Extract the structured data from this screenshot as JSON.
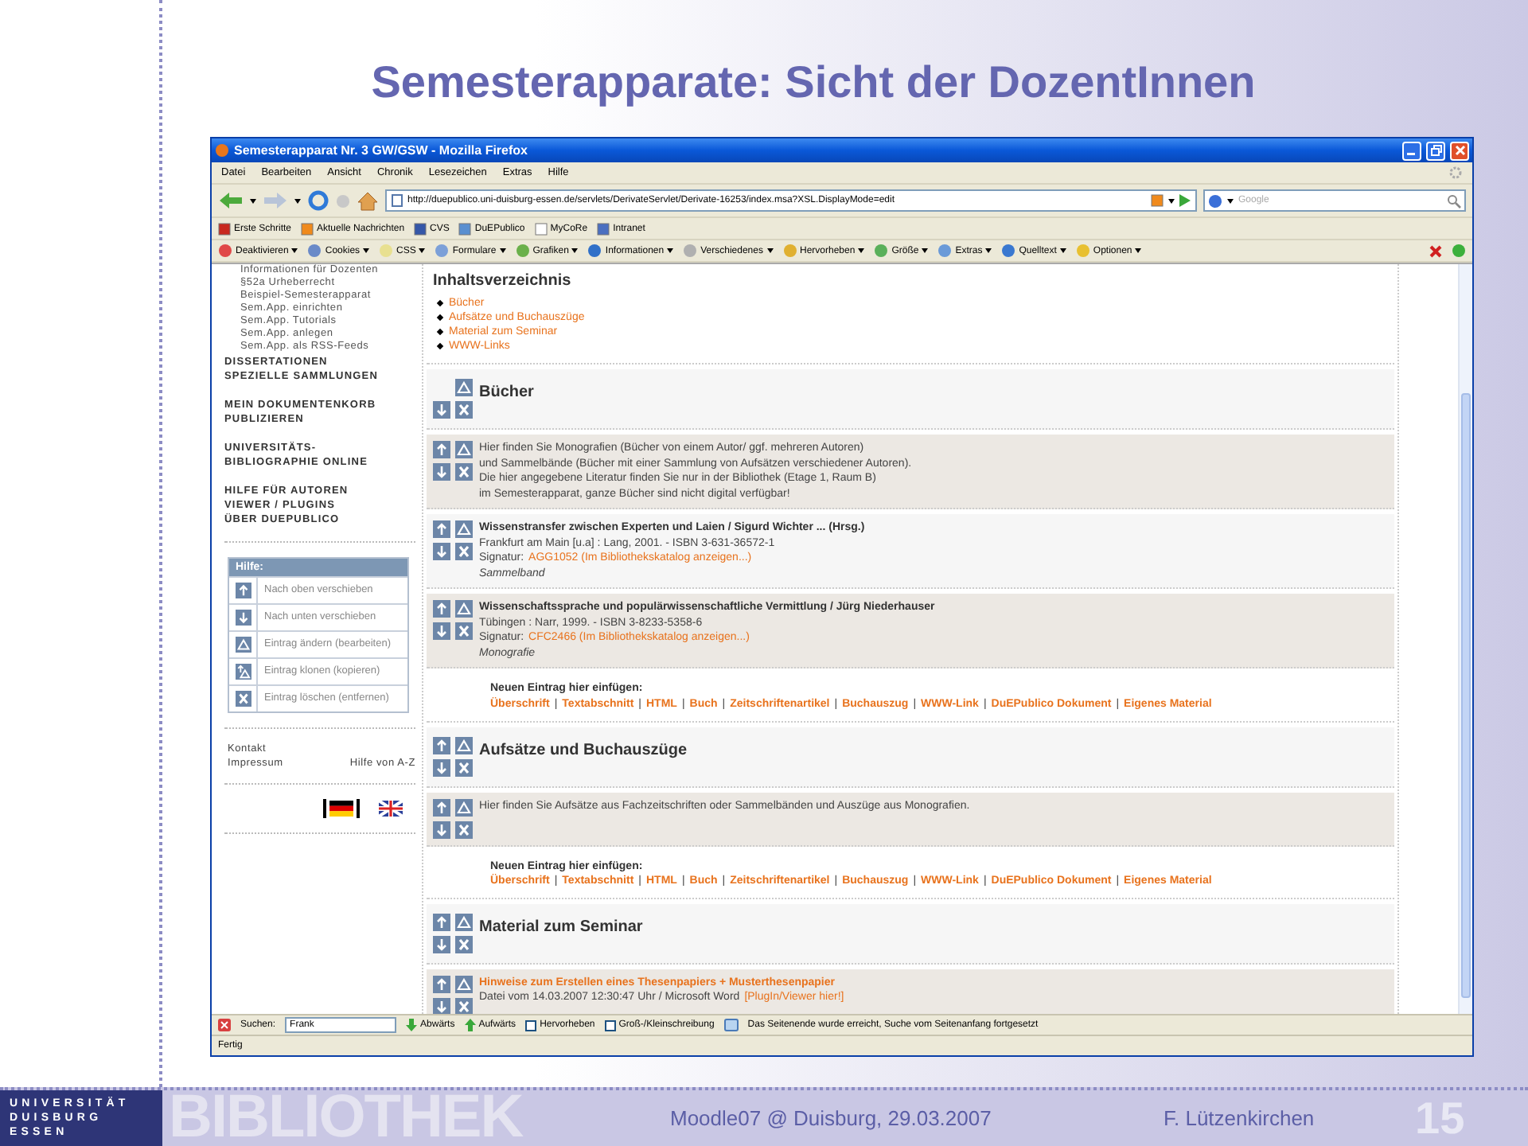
{
  "slide": {
    "title": "Semesterapparate: Sicht der DozentInnen",
    "footer": {
      "logo_lines": [
        "UNIVERSITÄT",
        "DUISBURG",
        "ESSEN"
      ],
      "wordmark": "BIBLIOTHEK",
      "event": "Moodle07 @ Duisburg, 29.03.2007",
      "author": "F. Lützenkirchen",
      "page": "15"
    }
  },
  "browser": {
    "title": "Semesterapparat Nr. 3 GW/GSW - Mozilla Firefox",
    "menu": [
      "Datei",
      "Bearbeiten",
      "Ansicht",
      "Chronik",
      "Lesezeichen",
      "Extras",
      "Hilfe"
    ],
    "url": "http://duepublico.uni-duisburg-essen.de/servlets/DerivateServlet/Derivate-16253/index.msa?XSL.DisplayMode=edit",
    "search_placeholder": "Google",
    "bookmarks": [
      "Erste Schritte",
      "Aktuelle Nachrichten",
      "CVS",
      "DuEPublico",
      "MyCoRe",
      "Intranet"
    ],
    "devtools": [
      "Deaktivieren",
      "Cookies",
      "CSS",
      "Formulare",
      "Grafiken",
      "Informationen",
      "Verschiedenes",
      "Hervorheben",
      "Größe",
      "Extras",
      "Quelltext",
      "Optionen"
    ],
    "find_bar": {
      "label": "Suchen:",
      "value": "Frank",
      "buttons": [
        {
          "kind": "down",
          "label": "Abwärts"
        },
        {
          "kind": "up",
          "label": "Aufwärts"
        }
      ],
      "options": [
        {
          "label": "Hervorheben",
          "checked": false
        },
        {
          "label": "Groß-/Kleinschreibung",
          "checked": false
        }
      ],
      "message": "Das Seitenende wurde erreicht, Suche vom Seitenanfang fortgesetzt"
    },
    "status": "Fertig"
  },
  "sidebar": {
    "sub_links": [
      "Informationen für Dozenten",
      "§52a Urheberrecht",
      "Beispiel-Semesterapparat",
      "Sem.App. einrichten",
      "Sem.App. Tutorials",
      "Sem.App. anlegen",
      "Sem.App. als RSS-Feeds"
    ],
    "groups": [
      [
        "DISSERTATIONEN",
        "SPEZIELLE SAMMLUNGEN"
      ],
      [
        "MEIN DOKUMENTENKORB",
        "PUBLIZIEREN"
      ],
      [
        "UNIVERSITÄTS-",
        "BIBLIOGRAPHIE ONLINE"
      ],
      [
        "HILFE FÜR AUTOREN",
        "VIEWER / PLUGINS",
        "ÜBER DUEPUBLICO"
      ]
    ],
    "help": {
      "title": "Hilfe:",
      "rows": [
        {
          "kind": "up",
          "text": "Nach oben verschieben"
        },
        {
          "kind": "down",
          "text": "Nach unten verschieben"
        },
        {
          "kind": "edit",
          "text": "Eintrag ändern (bearbeiten)"
        },
        {
          "kind": "clone",
          "text": "Eintrag klonen (kopieren)"
        },
        {
          "kind": "delete",
          "text": "Eintrag löschen (entfernen)"
        }
      ]
    },
    "footer_links": [
      "Kontakt",
      "Impressum",
      "Hilfe von A-Z"
    ],
    "languages": [
      {
        "kind": "de",
        "selected": true
      },
      {
        "kind": "en",
        "selected": false
      }
    ]
  },
  "content": {
    "toc": {
      "title": "Inhaltsverzeichnis",
      "items": [
        "Bücher",
        "Aufsätze und Buchauszüge",
        "Material zum Seminar",
        "WWW-Links"
      ]
    },
    "blocks": [
      {
        "kind": "heading",
        "can_move_up": false,
        "title": "Bücher"
      },
      {
        "kind": "text",
        "can_move_up": true,
        "lines": [
          "Hier finden Sie Monografien (Bücher von einem Autor/ ggf. mehreren Autoren)",
          "und Sammelbände (Bücher mit einer Sammlung von Aufsätzen verschiedener Autoren).",
          "Die hier angegebene Literatur finden Sie nur in der Bibliothek (Etage 1, Raum B)",
          "im Semesterapparat, ganze Bücher sind nicht digital verfügbar!"
        ]
      },
      {
        "kind": "entry",
        "can_move_up": true,
        "title": "Wissenstransfer zwischen Experten und Laien / Sigurd Wichter ... (Hrsg.)",
        "publication": "Frankfurt am Main [u.a] : Lang, 2001. - ISBN 3-631-36572-1",
        "signature_label": "Signatur:",
        "signature": "AGG1052 (Im Bibliothekskatalog anzeigen...)",
        "type": "Sammelband"
      },
      {
        "kind": "entry",
        "can_move_up": true,
        "title": "Wissenschaftssprache und populärwissenschaftliche Vermittlung / Jürg Niederhauser",
        "publication": "Tübingen : Narr, 1999. - ISBN 3-8233-5358-6",
        "signature_label": "Signatur:",
        "signature": "CFC2466 (Im Bibliothekskatalog anzeigen...)",
        "type": "Monografie"
      },
      {
        "kind": "insert",
        "label": "Neuen Eintrag hier einfügen:",
        "separator": "|",
        "links": [
          "Überschrift",
          "Textabschnitt",
          "HTML",
          "Buch",
          "Zeitschriftenartikel",
          "Buchauszug",
          "WWW-Link",
          "DuEPublico Dokument",
          "Eigenes Material"
        ]
      },
      {
        "kind": "heading",
        "can_move_up": true,
        "title": "Aufsätze und Buchauszüge"
      },
      {
        "kind": "text",
        "can_move_up": true,
        "lines": [
          "Hier finden Sie Aufsätze aus Fachzeitschriften oder Sammelbänden und Auszüge aus Monografien."
        ]
      },
      {
        "kind": "insert",
        "label": "Neuen Eintrag hier einfügen:",
        "separator": "|",
        "links": [
          "Überschrift",
          "Textabschnitt",
          "HTML",
          "Buch",
          "Zeitschriftenartikel",
          "Buchauszug",
          "WWW-Link",
          "DuEPublico Dokument",
          "Eigenes Material"
        ]
      },
      {
        "kind": "heading",
        "can_move_up": true,
        "title": "Material zum Seminar"
      },
      {
        "kind": "file",
        "can_move_up": true,
        "title": "Hinweise zum Erstellen eines Thesenpapiers + Musterthesenpapier",
        "info": "Datei vom 14.03.2007 12:30:47 Uhr / Microsoft Word",
        "viewer": "[PlugIn/Viewer hier!]"
      }
    ]
  }
}
